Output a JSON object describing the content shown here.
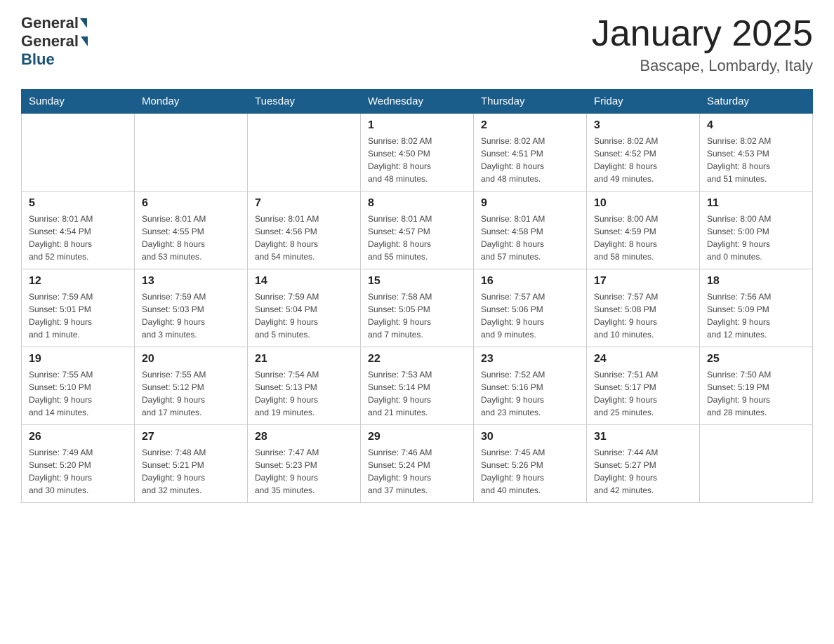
{
  "header": {
    "logo_general": "General",
    "logo_blue": "Blue",
    "month_title": "January 2025",
    "location": "Bascape, Lombardy, Italy"
  },
  "days_of_week": [
    "Sunday",
    "Monday",
    "Tuesday",
    "Wednesday",
    "Thursday",
    "Friday",
    "Saturday"
  ],
  "weeks": [
    [
      {
        "day": "",
        "info": ""
      },
      {
        "day": "",
        "info": ""
      },
      {
        "day": "",
        "info": ""
      },
      {
        "day": "1",
        "info": "Sunrise: 8:02 AM\nSunset: 4:50 PM\nDaylight: 8 hours\nand 48 minutes."
      },
      {
        "day": "2",
        "info": "Sunrise: 8:02 AM\nSunset: 4:51 PM\nDaylight: 8 hours\nand 48 minutes."
      },
      {
        "day": "3",
        "info": "Sunrise: 8:02 AM\nSunset: 4:52 PM\nDaylight: 8 hours\nand 49 minutes."
      },
      {
        "day": "4",
        "info": "Sunrise: 8:02 AM\nSunset: 4:53 PM\nDaylight: 8 hours\nand 51 minutes."
      }
    ],
    [
      {
        "day": "5",
        "info": "Sunrise: 8:01 AM\nSunset: 4:54 PM\nDaylight: 8 hours\nand 52 minutes."
      },
      {
        "day": "6",
        "info": "Sunrise: 8:01 AM\nSunset: 4:55 PM\nDaylight: 8 hours\nand 53 minutes."
      },
      {
        "day": "7",
        "info": "Sunrise: 8:01 AM\nSunset: 4:56 PM\nDaylight: 8 hours\nand 54 minutes."
      },
      {
        "day": "8",
        "info": "Sunrise: 8:01 AM\nSunset: 4:57 PM\nDaylight: 8 hours\nand 55 minutes."
      },
      {
        "day": "9",
        "info": "Sunrise: 8:01 AM\nSunset: 4:58 PM\nDaylight: 8 hours\nand 57 minutes."
      },
      {
        "day": "10",
        "info": "Sunrise: 8:00 AM\nSunset: 4:59 PM\nDaylight: 8 hours\nand 58 minutes."
      },
      {
        "day": "11",
        "info": "Sunrise: 8:00 AM\nSunset: 5:00 PM\nDaylight: 9 hours\nand 0 minutes."
      }
    ],
    [
      {
        "day": "12",
        "info": "Sunrise: 7:59 AM\nSunset: 5:01 PM\nDaylight: 9 hours\nand 1 minute."
      },
      {
        "day": "13",
        "info": "Sunrise: 7:59 AM\nSunset: 5:03 PM\nDaylight: 9 hours\nand 3 minutes."
      },
      {
        "day": "14",
        "info": "Sunrise: 7:59 AM\nSunset: 5:04 PM\nDaylight: 9 hours\nand 5 minutes."
      },
      {
        "day": "15",
        "info": "Sunrise: 7:58 AM\nSunset: 5:05 PM\nDaylight: 9 hours\nand 7 minutes."
      },
      {
        "day": "16",
        "info": "Sunrise: 7:57 AM\nSunset: 5:06 PM\nDaylight: 9 hours\nand 9 minutes."
      },
      {
        "day": "17",
        "info": "Sunrise: 7:57 AM\nSunset: 5:08 PM\nDaylight: 9 hours\nand 10 minutes."
      },
      {
        "day": "18",
        "info": "Sunrise: 7:56 AM\nSunset: 5:09 PM\nDaylight: 9 hours\nand 12 minutes."
      }
    ],
    [
      {
        "day": "19",
        "info": "Sunrise: 7:55 AM\nSunset: 5:10 PM\nDaylight: 9 hours\nand 14 minutes."
      },
      {
        "day": "20",
        "info": "Sunrise: 7:55 AM\nSunset: 5:12 PM\nDaylight: 9 hours\nand 17 minutes."
      },
      {
        "day": "21",
        "info": "Sunrise: 7:54 AM\nSunset: 5:13 PM\nDaylight: 9 hours\nand 19 minutes."
      },
      {
        "day": "22",
        "info": "Sunrise: 7:53 AM\nSunset: 5:14 PM\nDaylight: 9 hours\nand 21 minutes."
      },
      {
        "day": "23",
        "info": "Sunrise: 7:52 AM\nSunset: 5:16 PM\nDaylight: 9 hours\nand 23 minutes."
      },
      {
        "day": "24",
        "info": "Sunrise: 7:51 AM\nSunset: 5:17 PM\nDaylight: 9 hours\nand 25 minutes."
      },
      {
        "day": "25",
        "info": "Sunrise: 7:50 AM\nSunset: 5:19 PM\nDaylight: 9 hours\nand 28 minutes."
      }
    ],
    [
      {
        "day": "26",
        "info": "Sunrise: 7:49 AM\nSunset: 5:20 PM\nDaylight: 9 hours\nand 30 minutes."
      },
      {
        "day": "27",
        "info": "Sunrise: 7:48 AM\nSunset: 5:21 PM\nDaylight: 9 hours\nand 32 minutes."
      },
      {
        "day": "28",
        "info": "Sunrise: 7:47 AM\nSunset: 5:23 PM\nDaylight: 9 hours\nand 35 minutes."
      },
      {
        "day": "29",
        "info": "Sunrise: 7:46 AM\nSunset: 5:24 PM\nDaylight: 9 hours\nand 37 minutes."
      },
      {
        "day": "30",
        "info": "Sunrise: 7:45 AM\nSunset: 5:26 PM\nDaylight: 9 hours\nand 40 minutes."
      },
      {
        "day": "31",
        "info": "Sunrise: 7:44 AM\nSunset: 5:27 PM\nDaylight: 9 hours\nand 42 minutes."
      },
      {
        "day": "",
        "info": ""
      }
    ]
  ]
}
